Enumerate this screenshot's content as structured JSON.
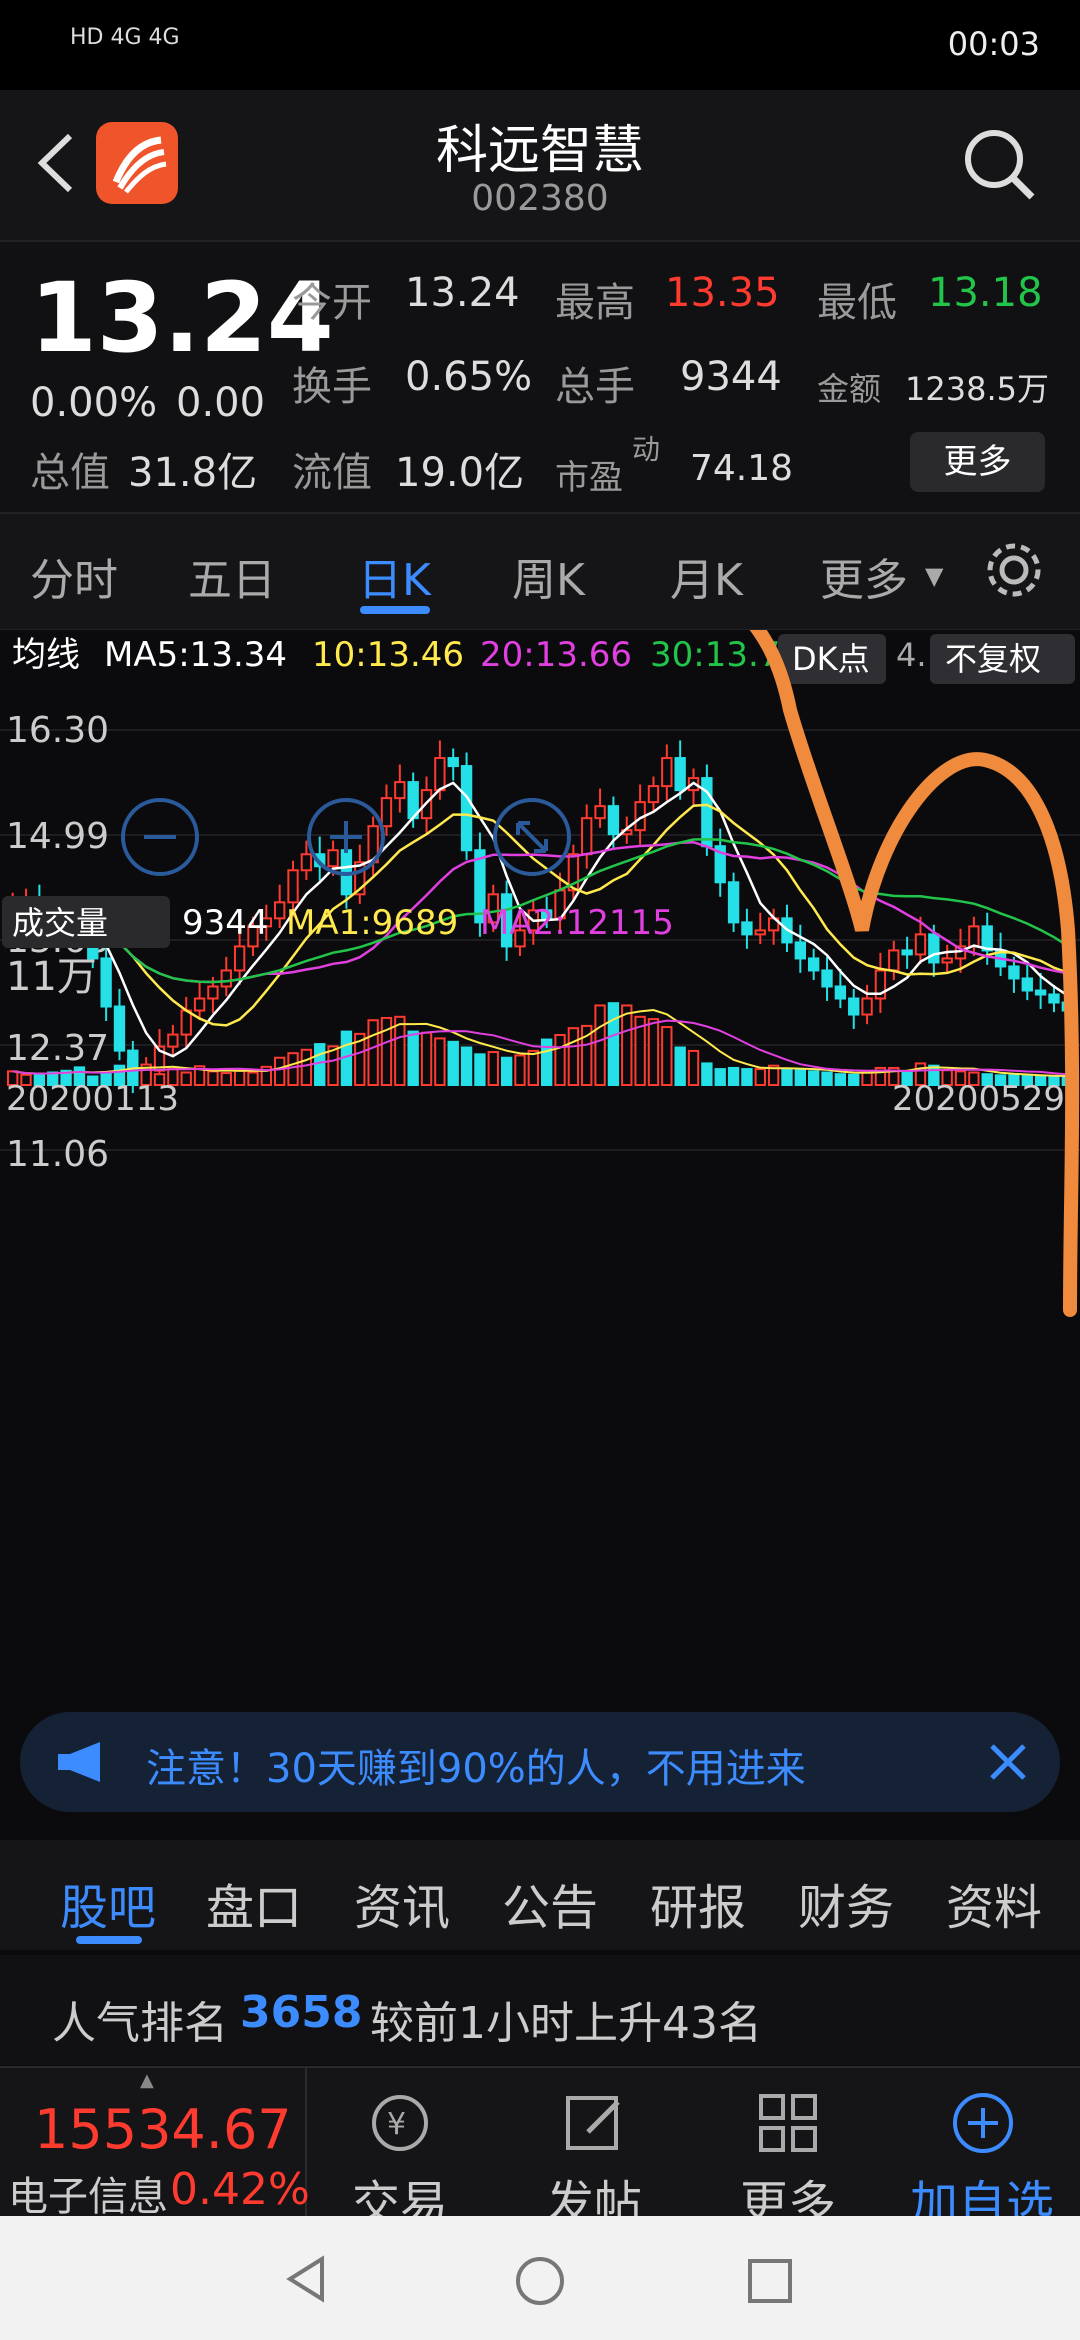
{
  "status_bar": {
    "left": "HD 4G 4G",
    "time": "00:03"
  },
  "header": {
    "name": "科远智慧",
    "code": "002380"
  },
  "quote": {
    "price": "13.24",
    "change_pct": "0.00%",
    "change": "0.00",
    "open_label": "今开",
    "open": "13.24",
    "high_label": "最高",
    "high": "13.35",
    "low_label": "最低",
    "low": "13.18",
    "turnover_label": "换手",
    "turnover": "0.65%",
    "volume_label": "总手",
    "volume": "9344",
    "amount_label": "金额",
    "amount": "1238.5万",
    "mcap_label": "总值",
    "mcap": "31.8亿",
    "float_label": "流值",
    "float": "19.0亿",
    "pe_label": "市盈",
    "pe_sup": "动",
    "pe": "74.18",
    "more": "更多"
  },
  "period_tabs": [
    "分时",
    "五日",
    "日K",
    "周K",
    "月K",
    "更多"
  ],
  "ma_bar": {
    "label": "均线",
    "ma5": "MA5:13.34",
    "ma10": "10:13.46",
    "ma20": "20:13.66",
    "ma30": "30:13.7",
    "dk": "DK点",
    "adj": "不复权",
    "extra": "4."
  },
  "price_axis": [
    "16.30",
    "14.99",
    "13.68",
    "12.37",
    "11.06"
  ],
  "volume_bar": {
    "label": "成交量",
    "vol": "9344",
    "ma1": "MA1:9689",
    "ma2": "MA2:12115",
    "axis_top": "11万"
  },
  "dates": {
    "start": "20200113",
    "end": "20200529"
  },
  "notice": "注意！30天赚到90%的人，不用进来",
  "feature_tabs": [
    "股吧",
    "盘口",
    "资讯",
    "公告",
    "研报",
    "财务",
    "资料"
  ],
  "rank": {
    "prefix": "人气排名",
    "value": "3658",
    "suffix": "较前1小时上升43名"
  },
  "index": {
    "value": "15534.67",
    "name": "电子信息",
    "pct": "0.42%"
  },
  "bottom_items": [
    "交易",
    "发帖",
    "更多",
    "加自选"
  ],
  "colors": {
    "up": "#ff3b30",
    "down": "#25e0e6",
    "accent": "#3c8cff",
    "ma5": "#ffffff",
    "ma10": "#ffe94d",
    "ma20": "#e040e0",
    "ma30": "#22c44a"
  },
  "chart_data": {
    "type": "candlestick",
    "ylim": [
      11.06,
      16.3
    ],
    "yticks": [
      16.3,
      14.99,
      13.68,
      12.37,
      11.06
    ],
    "x_start": "20200113",
    "x_end": "20200529",
    "close": [
      14.15,
      14.15,
      14.1,
      14.05,
      13.95,
      13.8,
      13.45,
      12.85,
      12.3,
      11.95,
      12.05,
      12.35,
      12.5,
      12.8,
      12.95,
      13.1,
      13.3,
      13.6,
      13.85,
      13.95,
      14.15,
      14.55,
      14.75,
      14.6,
      14.8,
      14.25,
      14.65,
      15.1,
      15.45,
      15.65,
      15.2,
      15.55,
      15.95,
      15.85,
      14.8,
      13.9,
      14.25,
      13.6,
      13.8,
      14.05,
      13.95,
      14.3,
      14.75,
      15.2,
      15.35,
      15.0,
      15.05,
      15.4,
      15.6,
      15.95,
      15.55,
      15.7,
      14.85,
      14.4,
      13.9,
      13.75,
      13.8,
      13.95,
      13.65,
      13.45,
      13.3,
      13.1,
      12.95,
      12.75,
      12.95,
      13.3,
      13.55,
      13.5,
      13.75,
      13.4,
      13.45,
      13.6,
      13.85,
      13.55,
      13.35,
      13.2,
      13.05,
      13.0,
      12.9,
      12.8
    ],
    "volume": [
      12000,
      9000,
      9000,
      11000,
      12500,
      15500,
      7500,
      11000,
      17000,
      22000,
      18000,
      9500,
      14000,
      11000,
      16500,
      12000,
      10500,
      12500,
      11000,
      16000,
      24000,
      28000,
      31000,
      36000,
      34000,
      47000,
      45000,
      57000,
      59000,
      60000,
      47000,
      46000,
      41000,
      38000,
      33000,
      27000,
      29000,
      24000,
      26000,
      30000,
      40000,
      44000,
      50000,
      52000,
      70000,
      72000,
      70000,
      60000,
      58000,
      51000,
      33000,
      30000,
      19000,
      14000,
      15000,
      14000,
      14000,
      17000,
      14000,
      13000,
      12000,
      11000,
      9500,
      9000,
      12000,
      15000,
      15000,
      12000,
      19000,
      17000,
      13000,
      12000,
      11000,
      9500,
      8500,
      8500,
      8500,
      8000,
      7500,
      7000
    ],
    "volume_axis_top": "11万",
    "series_ma": {
      "MA5": "13.34",
      "MA10": "13.46",
      "MA20": "13.66",
      "MA30": "13.7"
    }
  }
}
